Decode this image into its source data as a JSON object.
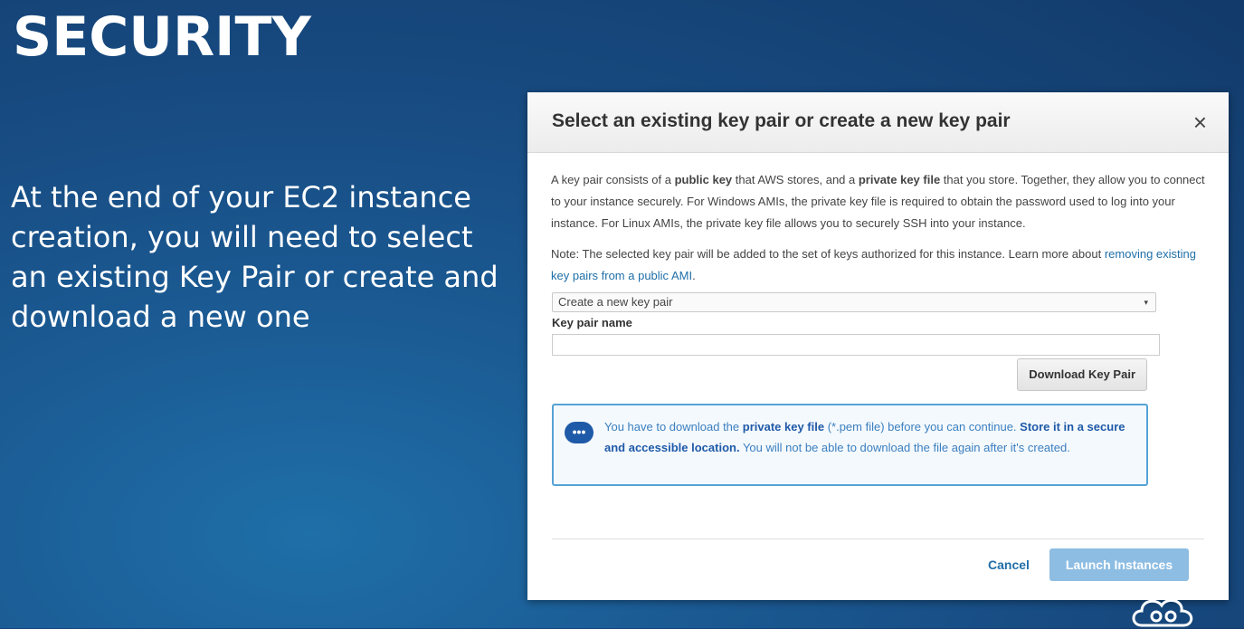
{
  "slide": {
    "title": "SECURITY",
    "body": "At the end of your EC2 instance creation, you will need to select an existing Key Pair or create and download a new one"
  },
  "modal": {
    "title": "Select an existing key pair or create a new key pair",
    "close_label": "×",
    "description": {
      "p1_part1": "A key pair consists of a ",
      "p1_bold1": "public key",
      "p1_part2": " that AWS stores, and a ",
      "p1_bold2": "private key file",
      "p1_part3": " that you store. Together, they allow you to connect to your instance securely. For Windows AMIs, the private key file is required to obtain the password used to log into your instance. For Linux AMIs, the private key file allows you to securely SSH into your instance."
    },
    "note": {
      "text": "Note: The selected key pair will be added to the set of keys authorized for this instance. Learn more about ",
      "link": "removing existing key pairs from a public AMI",
      "suffix": "."
    },
    "select": {
      "value": "Create a new key pair",
      "arrow": "▾"
    },
    "key_pair_name_label": "Key pair name",
    "key_pair_name_value": "",
    "download_button": "Download Key Pair",
    "info": {
      "icon": "chat-bubble-icon",
      "icon_glyph": "•••",
      "part1": "You have to download the ",
      "bold1": "private key file",
      "part2": " (*.pem file) before you can continue. ",
      "bold2": "Store it in a secure and accessible location.",
      "part3": " You will not be able to download the file again after it's created."
    },
    "cancel_button": "Cancel",
    "launch_button": "Launch Instances"
  },
  "colors": {
    "background": "#174a80",
    "link": "#1f6fa8",
    "launch_disabled": "#8dbde3",
    "info_border": "#55a3d6"
  }
}
